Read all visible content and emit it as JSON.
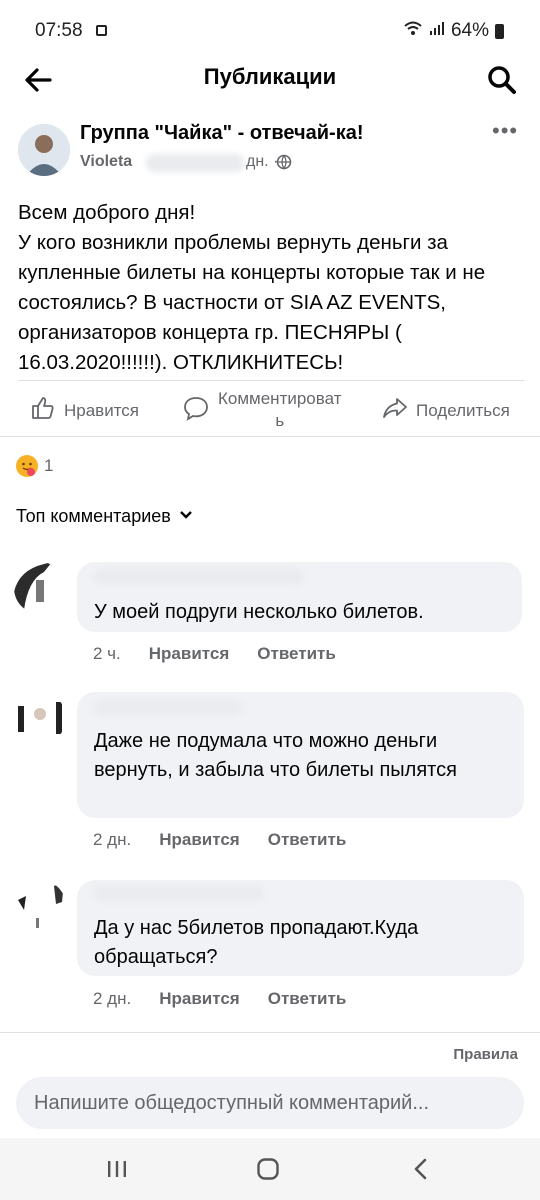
{
  "status_bar": {
    "time": "07:58",
    "battery": "64%"
  },
  "header": {
    "title": "Публикации"
  },
  "post": {
    "group_name": "Группа \"Чайка\" - отвечай-ка!",
    "author": "Violeta",
    "timestamp": "дн. ·",
    "text": "Всем доброго дня!\nУ кого возникли проблемы вернуть деньги за купленные билеты на концерты которые так и не состоялись? В частности от SIA AZ EVENTS, организаторов концерта гр. ПЕСНЯРЫ ( 16.03.2020!!!!!!). ОТКЛИКНИТЕСЬ!",
    "actions": {
      "like": "Нравится",
      "comment_line1": "Комментироват",
      "comment_line2": "ь",
      "share": "Поделиться"
    },
    "reaction_count": "1"
  },
  "comments_section": {
    "sort_label": "Топ комментариев",
    "comments": [
      {
        "text": "У моей подруги несколько билетов.",
        "time": "2 ч.",
        "like": "Нравится",
        "reply": "Ответить"
      },
      {
        "text": "Даже не подумала что можно деньги вернуть, и забыла что билеты пылятся",
        "time": "2 дн.",
        "like": "Нравится",
        "reply": "Ответить"
      },
      {
        "text": "Да у нас 5билетов пропадают.Куда обращаться?",
        "time": "2 дн.",
        "like": "Нравится",
        "reply": "Ответить"
      }
    ]
  },
  "rules_link": "Правила",
  "composer": {
    "placeholder": "Напишите общедоступный комментарий..."
  },
  "icons": {
    "back": "arrow-left-icon",
    "search": "search-icon",
    "more": "more-icon",
    "like": "thumbs-up-icon",
    "comment": "comment-icon",
    "share": "share-icon",
    "globe": "globe-icon",
    "sort": "chevron-down-icon"
  },
  "colors": {
    "text": "#050505",
    "secondary": "#65676b",
    "bubble": "#f0f2f5",
    "divider": "#dcdfe3"
  }
}
